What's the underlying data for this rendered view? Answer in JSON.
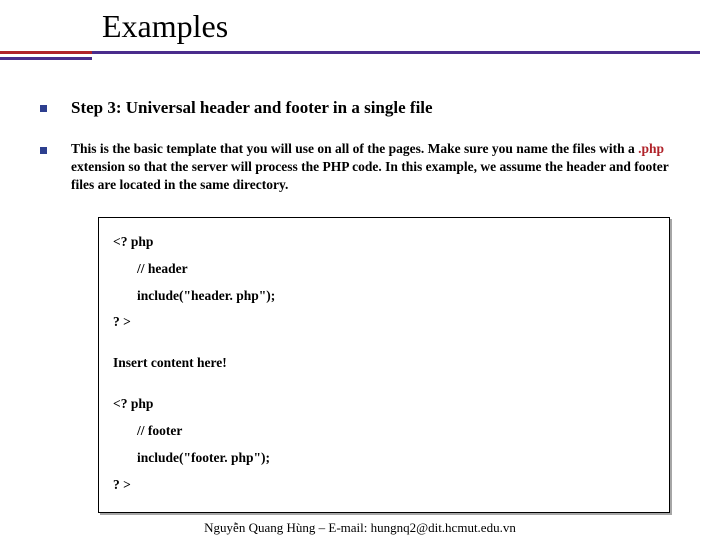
{
  "title": "Examples",
  "step_heading": "Step 3: Universal header and footer in a single file",
  "description": {
    "before": "This is the basic template that you will use on all of the pages. Make sure you name the files with a ",
    "highlight": ".php",
    "after": " extension so that the server will process the PHP code. In this example, we assume the header and footer files are located in the same directory."
  },
  "code": {
    "open1": "<? php",
    "comment1": "// header",
    "include1": "include(\"header. php\");",
    "close1": "? >",
    "content": "Insert content here!",
    "open2": "<? php",
    "comment2": "// footer",
    "include2": "include(\"footer. php\");",
    "close2": "? >"
  },
  "footer": "Nguyễn Quang Hùng – E-mail: hungnq2@dit.hcmut.edu.vn"
}
